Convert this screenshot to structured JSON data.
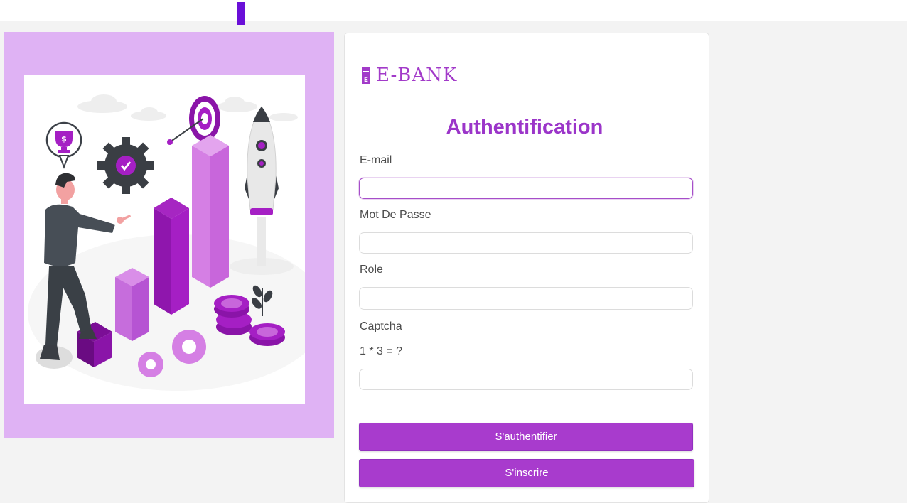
{
  "brand": {
    "name": "E-BANK",
    "icon": "bank-logo-icon"
  },
  "form": {
    "title": "Authentification",
    "email_label": "E-mail",
    "email_value": "",
    "password_label": "Mot De Passe",
    "password_value": "",
    "role_label": "Role",
    "role_value": "",
    "captcha_label": "Captcha",
    "captcha_question": "1 * 3 = ?",
    "captcha_value": ""
  },
  "buttons": {
    "login_label": "S'authentifier",
    "register_label": "S'inscrire"
  },
  "illustration": {
    "icon": "business-growth-illustration"
  },
  "colors": {
    "accent": "#a83bcd",
    "title": "#9b35c9",
    "panel": "#dfb2f4",
    "topbar_mark": "#6a0fd8"
  }
}
